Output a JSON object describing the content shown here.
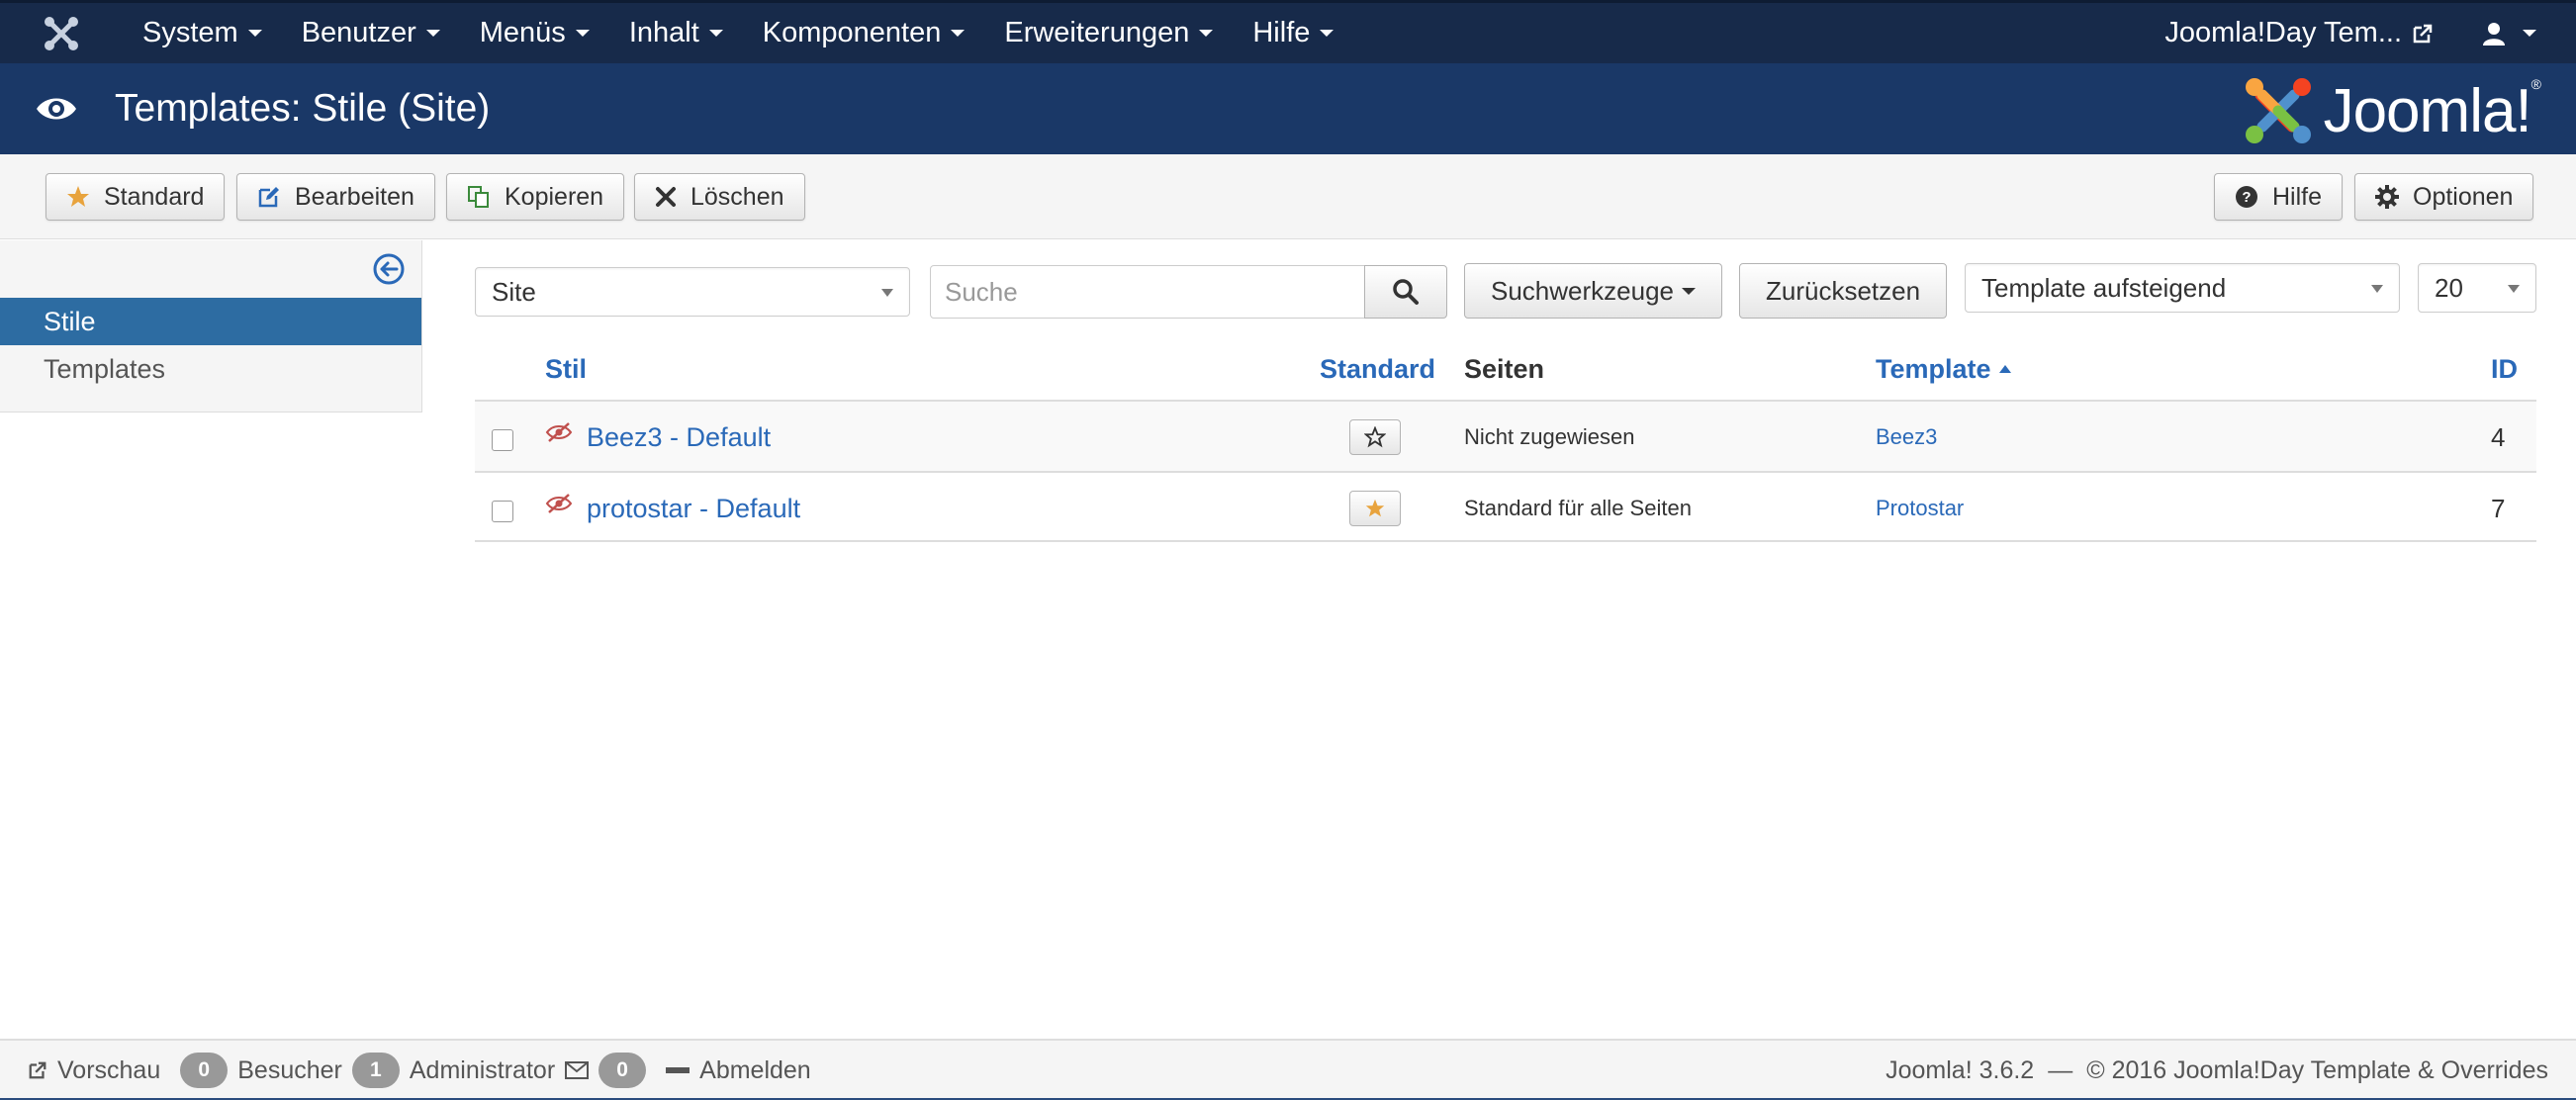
{
  "navbar": {
    "menu": [
      {
        "label": "System"
      },
      {
        "label": "Benutzer"
      },
      {
        "label": "Menüs"
      },
      {
        "label": "Inhalt"
      },
      {
        "label": "Komponenten"
      },
      {
        "label": "Erweiterungen"
      },
      {
        "label": "Hilfe"
      }
    ],
    "site_link": "Joomla!Day Tem..."
  },
  "header": {
    "title": "Templates: Stile (Site)",
    "brand": "Joomla!",
    "brand_reg": "®"
  },
  "toolbar": {
    "standard": "Standard",
    "edit": "Bearbeiten",
    "copy": "Kopieren",
    "delete": "Löschen",
    "help": "Hilfe",
    "options": "Optionen"
  },
  "sidebar": {
    "items": [
      {
        "label": "Stile",
        "active": true
      },
      {
        "label": "Templates",
        "active": false
      }
    ]
  },
  "filters": {
    "client": "Site",
    "search_placeholder": "Suche",
    "search_tools": "Suchwerkzeuge",
    "reset": "Zurücksetzen",
    "ordering": "Template aufsteigend",
    "limit": "20"
  },
  "table": {
    "headers": {
      "style": "Stil",
      "default": "Standard",
      "pages": "Seiten",
      "template": "Template",
      "id": "ID"
    },
    "rows": [
      {
        "style": "Beez3 - Default",
        "is_default": false,
        "pages": "Nicht zugewiesen",
        "template": "Beez3",
        "id": "4"
      },
      {
        "style": "protostar - Default",
        "is_default": true,
        "pages": "Standard für alle Seiten",
        "template": "Protostar",
        "id": "7"
      }
    ]
  },
  "footer": {
    "preview": "Vorschau",
    "visitors_count": "0",
    "visitors": "Besucher",
    "admins_count": "1",
    "admins": "Administrator",
    "messages_count": "0",
    "logout": "Abmelden",
    "version": "Joomla! 3.6.2",
    "separator": "—",
    "copyright": "© 2016 Joomla!Day Template & Overrides"
  },
  "colors": {
    "navbar_bg": "#172a4a",
    "header_bg": "#1a3867",
    "link": "#2a69b8",
    "active_sidebar": "#2d6ca2",
    "star_default": "#e8a33d"
  },
  "icons": [
    "joomla-icon",
    "external-link-icon",
    "user-icon",
    "eye-icon",
    "star-icon",
    "edit-icon",
    "copy-icon",
    "close-icon",
    "question-icon",
    "gear-icon",
    "arrow-left-circle-icon",
    "search-icon",
    "eye-slash-icon",
    "sort-up-icon",
    "mail-icon",
    "minus-icon"
  ]
}
